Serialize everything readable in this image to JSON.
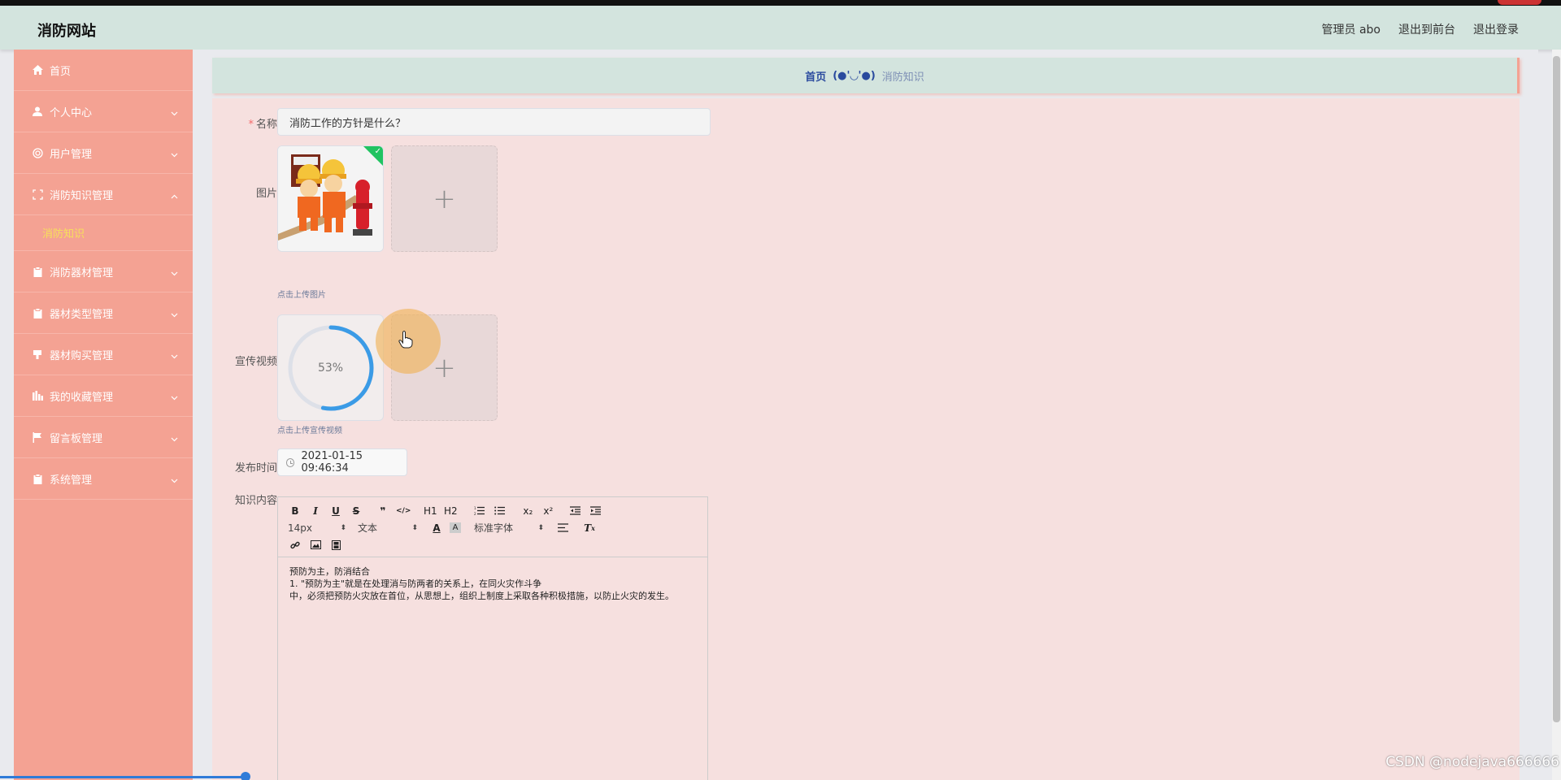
{
  "header": {
    "site_title": "消防网站",
    "admin_label": "管理员 abo",
    "exit_front": "退出到前台",
    "logout": "退出登录"
  },
  "sidebar": {
    "items": [
      {
        "label": "首页",
        "icon": "home-icon"
      },
      {
        "label": "个人中心",
        "icon": "user-icon"
      },
      {
        "label": "用户管理",
        "icon": "target-icon"
      },
      {
        "label": "消防知识管理",
        "icon": "fullscreen-icon",
        "expanded": true
      },
      {
        "label": "消防器材管理",
        "icon": "clipboard-icon"
      },
      {
        "label": "器材类型管理",
        "icon": "clipboard-icon"
      },
      {
        "label": "器材购买管理",
        "icon": "cup-icon"
      },
      {
        "label": "我的收藏管理",
        "icon": "bars-icon"
      },
      {
        "label": "留言板管理",
        "icon": "flag-icon"
      },
      {
        "label": "系统管理",
        "icon": "clipboard-icon"
      }
    ],
    "sub_active": "消防知识"
  },
  "breadcrumb": {
    "home": "首页",
    "sep": "(●'◡'●)",
    "current": "消防知识"
  },
  "form": {
    "name_label": "名称",
    "name_value": "消防工作的方针是什么？",
    "image_label": "图片",
    "image_hint": "点击上传图片",
    "video_label": "宣传视频",
    "video_progress": "53%",
    "video_progress_value": 0.53,
    "video_hint": "点击上传宣传视频",
    "date_label": "发布时间",
    "date_value": "2021-01-15 09:46:34",
    "content_label": "知识内容"
  },
  "editor": {
    "toolbar_row1": [
      "B",
      "I",
      "U",
      "S",
      "❞",
      "</>",
      "H1",
      "H2",
      "ol",
      "ul",
      "x₂",
      "x²",
      "outdent",
      "indent"
    ],
    "font_size": "14px",
    "text_type": "文本",
    "font_family": "标准字体",
    "content_lines": [
      "预防为主，防消结合",
      "1. \"预防为主\"就是在处理消与防两者的关系上，在同火灾作斗争",
      "中，必须把预防火灾放在首位，从思想上，组织上制度上采取各种积极措施，以防止火灾的发生。"
    ]
  },
  "watermark": "CSDN @nodejava666666",
  "colors": {
    "header_bg": "#d3e4de",
    "sidebar_bg": "#f4a293",
    "panel_bg": "#f6e0df",
    "active_sub": "#f7e05a",
    "success": "#21c361",
    "progress": "#3b9be6"
  }
}
